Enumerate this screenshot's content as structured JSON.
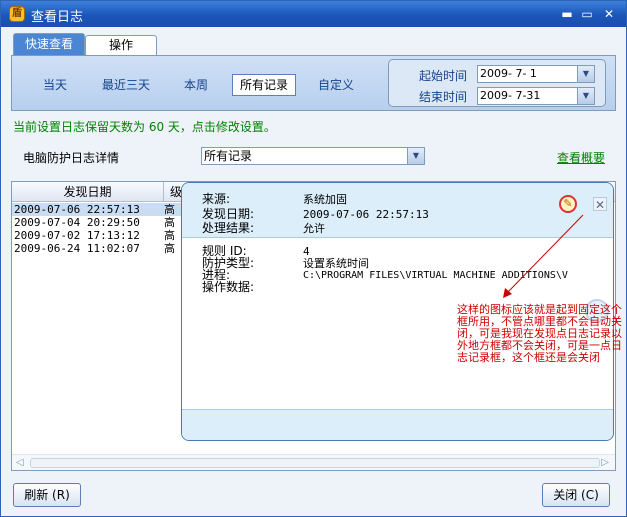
{
  "window": {
    "title": "查看日志",
    "controls": {
      "minimize": "▬",
      "maximize": "▭",
      "close": "✕"
    }
  },
  "tabs": [
    {
      "label": "快速查看",
      "active": true
    },
    {
      "label": "操作",
      "active": false
    }
  ],
  "periods": [
    {
      "label": "当天"
    },
    {
      "label": "最近三天"
    },
    {
      "label": "本周"
    },
    {
      "label": "所有记录",
      "selected": true
    },
    {
      "label": "自定义"
    }
  ],
  "date_range": {
    "start_label": "起始时间",
    "start_value": "2009- 7- 1",
    "end_label": "结束时间",
    "end_value": "2009- 7-31"
  },
  "notice": "当前设置日志保留天数为 60 天，点击修改设置。",
  "log_section": {
    "label": "电脑防护日志详情",
    "select_value": "所有记录",
    "overview_link": "查看概要"
  },
  "log_list": {
    "columns": [
      "发现日期",
      "级"
    ],
    "rows": [
      {
        "date": "2009-07-06 22:57:13",
        "level": "高",
        "selected": true
      },
      {
        "date": "2009-07-04 20:29:50",
        "level": "高"
      },
      {
        "date": "2009-07-02 17:13:12",
        "level": "高"
      },
      {
        "date": "2009-06-24 11:02:07",
        "level": "高"
      }
    ]
  },
  "detail_popup": {
    "source_label": "来源:",
    "source_value": "系统加固",
    "found_label": "发现日期:",
    "found_value": "2009-07-06 22:57:13",
    "result_label": "处理结果:",
    "result_value": "允许",
    "rule_label": "规则 ID:",
    "rule_value": "4",
    "type_label": "防护类型:",
    "type_value": "设置系统时间",
    "process_label": "进程:",
    "process_value": "C:\\PROGRAM FILES\\VIRTUAL MACHINE ADDITIONS\\V",
    "data_label": "操作数据:",
    "pin_icon": "pin-icon",
    "close_icon": "close-icon"
  },
  "annotation": "这样的图标应该就是起到固定这个框所用，不管点哪里都不会自动关闭，可是我现在发现点日志记录以外地方框都不会关闭，可是一点日志记录框，这个框还是会关闭",
  "buttons": {
    "refresh": "刷新 (R)",
    "close": "关闭 (C)"
  },
  "colors": {
    "titlebar": "#1b56b8",
    "accent": "#4a86d4",
    "notice": "#008000",
    "annotation": "#cc0000"
  }
}
